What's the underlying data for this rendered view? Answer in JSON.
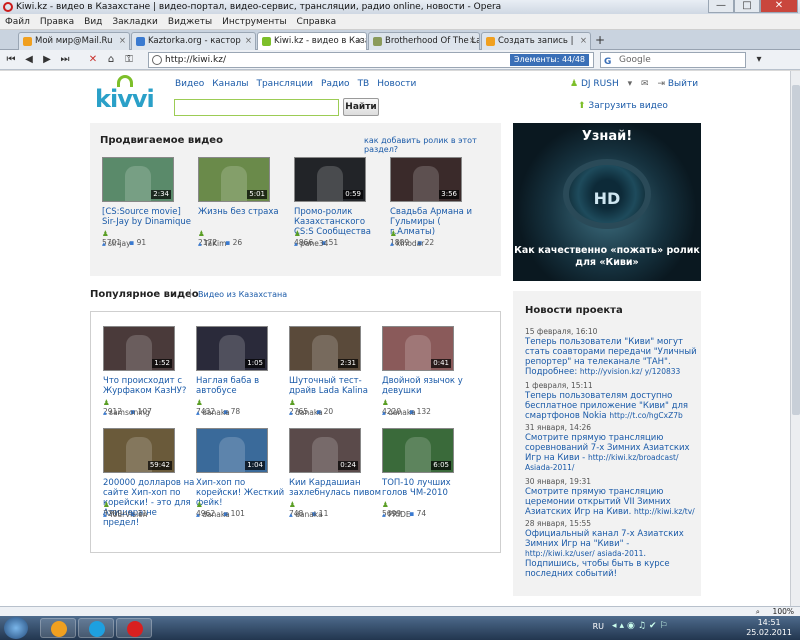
{
  "window": {
    "title": "Kiwi.kz - видео в Казахстане | видео-портал, видео-сервис, трансляции, радио online, новости - Opera",
    "min": "—",
    "max": "□",
    "close": "✕"
  },
  "menu": [
    "Файл",
    "Правка",
    "Вид",
    "Закладки",
    "Виджеты",
    "Инструменты",
    "Справка"
  ],
  "tabs": [
    {
      "label": "Мой мир@Mail.Ru",
      "color": "#f0a020"
    },
    {
      "label": "Kaztorka.org - кастор",
      "color": "#3a7ad0"
    },
    {
      "label": "Kiwi.kz - видео в Казах",
      "color": "#7dbf2a"
    },
    {
      "label": "Brotherhood Of The La",
      "color": "#8a9a5a"
    },
    {
      "label": "Создать запись |",
      "color": "#f0a020"
    }
  ],
  "address": {
    "url": "http://kiwi.kz/",
    "elements": "Элементы: 44/48",
    "search_placeholder": "Google"
  },
  "site": {
    "logo": "kivvi",
    "nav": [
      "Видео",
      "Каналы",
      "Трансляции",
      "Радио",
      "ТВ",
      "Новости"
    ],
    "search_button": "Найти",
    "user": "DJ RUSH",
    "logout": "Выйти",
    "upload": "Загрузить видео"
  },
  "promo": {
    "title": "Продвигаемое видео",
    "howto": "как добавить ролик в этот раздел?",
    "videos": [
      {
        "title": "[CS:Source movie] Sir-Jay by Dinamique",
        "views": "5701",
        "comments": "91",
        "user": "sir-jay",
        "duration": "2:34",
        "bg": "#5a8a6a"
      },
      {
        "title": "Жизнь без страха",
        "views": "2172",
        "comments": "26",
        "user": "TaKim",
        "duration": "5:01",
        "bg": "#6a8a4a"
      },
      {
        "title": "Промо-ролик Казахстанского CS:S Сообщества",
        "views": "4866",
        "comments": "51",
        "user": "pane34",
        "duration": "0:59",
        "bg": "#222428"
      },
      {
        "title": "Свадьба Армана и Гульмиры ( г.Алматы)",
        "views": "1889",
        "comments": "22",
        "user": "kinodar",
        "duration": "3:56",
        "bg": "#3a2a2a"
      }
    ]
  },
  "banner": {
    "top": "Узнай!",
    "hd": "HD",
    "bottom": "Как качественно «пожать» ролик для «Киви»"
  },
  "popular": {
    "title": "Популярное видео",
    "sub": "Видео из Казахстана",
    "videos": [
      {
        "title": "Что происходит с Журфаком КазНУ?",
        "views": "2912",
        "comments": "107",
        "user": "samsoning",
        "duration": "1:52",
        "bg": "#4a3a3a"
      },
      {
        "title": "Наглая баба в автобусе",
        "views": "7432",
        "comments": "78",
        "user": "danaka",
        "duration": "1:05",
        "bg": "#2a2a3a"
      },
      {
        "title": "Шуточный тест-драйв Lada Kalina",
        "views": "2765",
        "comments": "20",
        "user": "danaka",
        "duration": "2:31",
        "bg": "#5a4a3a"
      },
      {
        "title": "Двойной язычок у девушки",
        "views": "4220",
        "comments": "132",
        "user": "danaka",
        "duration": "0:41",
        "bg": "#8a5a5a"
      },
      {
        "title": "200000 долларов на сайте Хип-хоп по корейски! - это для Алишера не предел!",
        "views": "3209",
        "comments": "11",
        "user": "YourVision",
        "duration": "59:42",
        "bg": "#6a5a3a"
      },
      {
        "title": "Хип-хоп по корейски! Жесткий фейк!",
        "views": "4962",
        "comments": "101",
        "user": "danaka",
        "duration": "1:04",
        "bg": "#3a6a9a"
      },
      {
        "title": "Кии Кардашиан захлебнулась пивом",
        "views": "748",
        "comments": "11",
        "user": "danaka",
        "duration": "0:24",
        "bg": "#5a4a4a"
      },
      {
        "title": "ТОП-10 лучших голов ЧМ-2010",
        "views": "5699",
        "comments": "74",
        "user": "PRIDE",
        "duration": "6:05",
        "bg": "#3a6a3a"
      }
    ]
  },
  "news": {
    "title": "Новости проекта",
    "items": [
      {
        "date": "15 февраля, 16:10",
        "text": "Теперь пользователи \"Киви\" могут стать соавторами передачи \"Уличный репортер\" на телеканале \"ТАН\". Подробнее:",
        "url": "http://yvision.kz/ y/120833"
      },
      {
        "date": "1 февраля, 15:11",
        "text": "Теперь пользователям доступно бесплатное приложение \"Киви\" для смартфонов Nokia",
        "url": "http://t.co/hgCxZ7b"
      },
      {
        "date": "31 января, 14:26",
        "text": "Смотрите прямую трансляцию соревнований 7-х Зимних Азиатских Игр на Киви -",
        "url": "http://kiwi.kz/broadcast/ Asiada-2011/"
      },
      {
        "date": "30 января, 19:31",
        "text": "Смотрите прямую трансляцию церемонии открытий VII Зимних Азиатских Игр на Киви.",
        "url": "http://kiwi.kz/tv/"
      },
      {
        "date": "28 января, 15:55",
        "text": "Официальный канал 7-х Азиатских Зимних Игр на \"Киви\" -",
        "url": "http://kiwi.kz/user/ asiada-2011",
        "tail": ". Подпишись, чтобы быть в курсе последних событий!"
      }
    ]
  },
  "status": {
    "zoom": "100%"
  },
  "taskbar": {
    "lang": "RU",
    "time": "14:51",
    "date": "25.02.2011"
  },
  "colors": {
    "brand_green": "#7dbf2a",
    "brand_blue": "#2aa0c8",
    "link": "#1a5aa8"
  }
}
